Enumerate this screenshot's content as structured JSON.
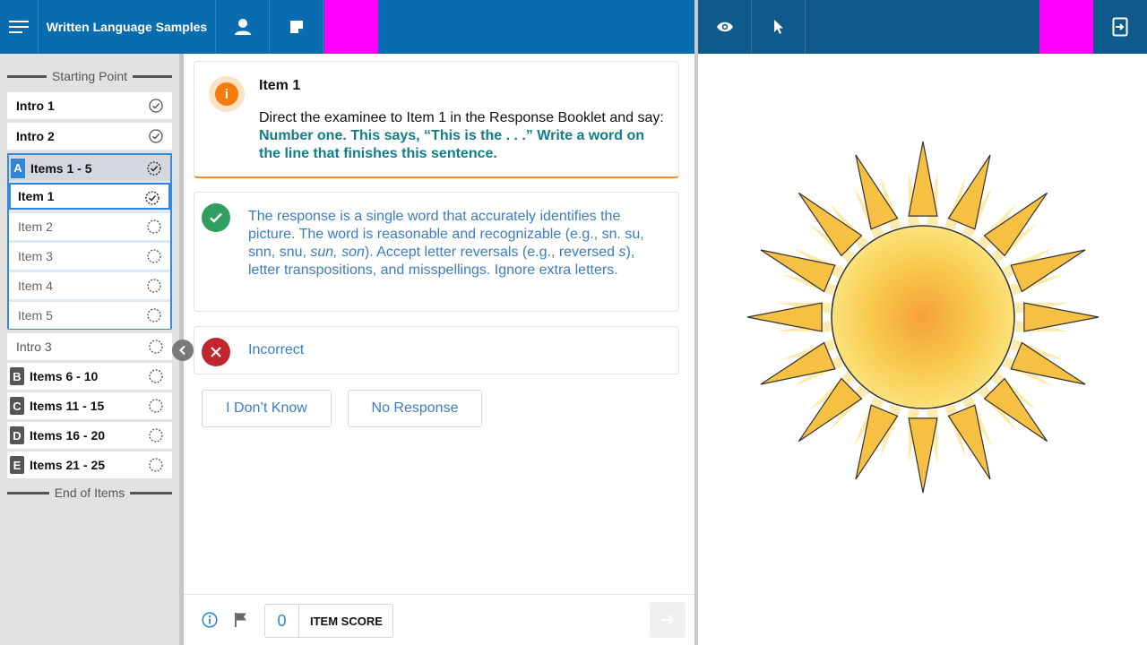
{
  "header": {
    "title": "Written Language Samples",
    "icons": [
      "menu-icon",
      "person-icon",
      "note-icon",
      "eye-icon",
      "pointer-icon",
      "exit-icon"
    ]
  },
  "sidebar": {
    "start_label": "Starting Point",
    "end_label": "End of Items",
    "intros": [
      {
        "label": "Intro 1",
        "status": "complete"
      },
      {
        "label": "Intro 2",
        "status": "complete"
      }
    ],
    "active_group": {
      "badge": "A",
      "label": "Items 1 - 5",
      "status": "in-progress",
      "items": [
        {
          "label": "Item 1",
          "status": "in-progress"
        },
        {
          "label": "Item 2",
          "status": "not-started"
        },
        {
          "label": "Item 3",
          "status": "not-started"
        },
        {
          "label": "Item 4",
          "status": "not-started"
        },
        {
          "label": "Item 5",
          "status": "not-started"
        }
      ]
    },
    "intro3": "Intro 3",
    "groups": [
      {
        "badge": "B",
        "label": "Items 6 - 10"
      },
      {
        "badge": "C",
        "label": "Items 11 - 15"
      },
      {
        "badge": "D",
        "label": "Items 16 - 20"
      },
      {
        "badge": "E",
        "label": "Items 21 - 25"
      }
    ]
  },
  "main": {
    "item_title": "Item 1",
    "instruction_prefix": "Direct the examinee to Item 1 in the Response Booklet and say: ",
    "instruction_say": "Number one. This says, “This is the . . .” Write a word on the line that finishes this sentence.",
    "correct_response": {
      "p1": "The response is a single word that accurately identifies the picture. The word is reasonable and recognizable (e.g., sn. su, snn, snu, ",
      "p1_italic": "sun, son",
      "p2": "). Accept letter reversals (e.g., reversed ",
      "p2_italic": "s",
      "p3": "), letter transpositions, and misspellings. Ignore extra letters."
    },
    "incorrect_label": "Incorrect",
    "buttons": {
      "dont_know": "I Don’t Know",
      "no_response": "No Response"
    }
  },
  "footer": {
    "item_score_value": "0",
    "item_score_label": "ITEM SCORE"
  },
  "colors": {
    "header": "#0a6cb0",
    "header_right": "#0f5a8c",
    "accent": "#2f86d6",
    "say_text": "#107d88",
    "response_text": "#3b7cc4",
    "correct": "#2f9e5f",
    "incorrect": "#c0262d",
    "info": "#f57c0c"
  }
}
